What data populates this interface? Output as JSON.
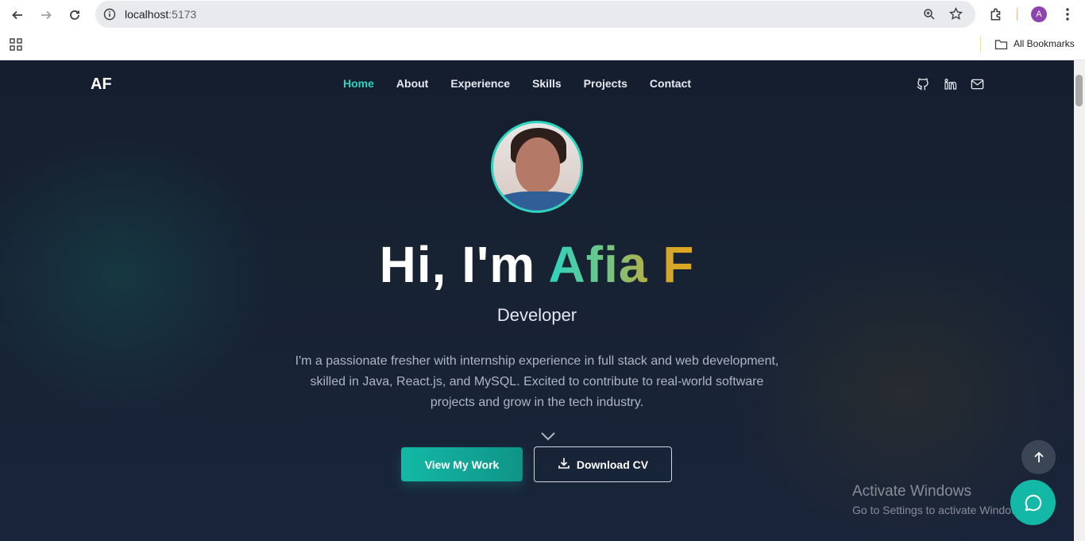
{
  "browser": {
    "url_host": "localhost",
    "url_port": ":5173",
    "bookmarks_label": "All Bookmarks",
    "profile_initial": "A"
  },
  "header": {
    "logo": "AF",
    "nav": [
      "Home",
      "About",
      "Experience",
      "Skills",
      "Projects",
      "Contact"
    ],
    "active_nav": "Home",
    "social_icons": [
      "github-icon",
      "linkedin-icon",
      "mail-icon"
    ]
  },
  "hero": {
    "greeting": "Hi, I'm ",
    "name": "Afia F",
    "role": "Developer",
    "bio": "I'm a passionate fresher with internship experience in full stack and web development, skilled in Java, React.js, and MySQL. Excited to contribute to real-world software projects and grow in the tech industry.",
    "primary_button": "View My Work",
    "secondary_button": "Download CV"
  },
  "overlay": {
    "activate_title": "Activate Windows",
    "activate_sub": "Go to Settings to activate Windows."
  },
  "colors": {
    "accent": "#2dd4bf",
    "name_gradient_end": "#e0a820",
    "background": "#172233"
  }
}
